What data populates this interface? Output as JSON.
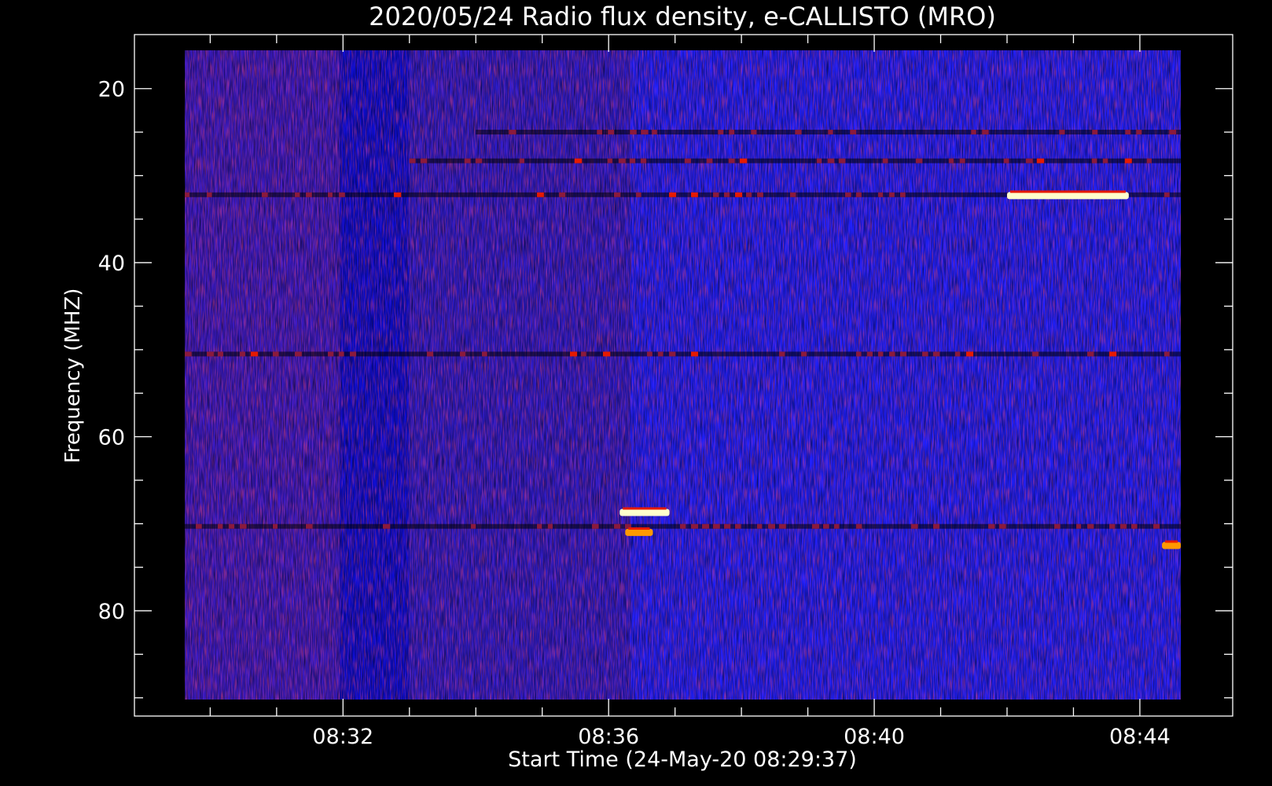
{
  "chart_data": {
    "type": "heatmap",
    "title": "2020/05/24  Radio flux density, e-CALLISTO (MRO)",
    "xlabel": "Start Time (24-May-20 08:29:37)",
    "ylabel": "Frequency (MHZ)",
    "x_range": [
      "08:29:37",
      "08:44:37"
    ],
    "y_range": [
      90.2,
      15.6
    ],
    "y_inverted": true,
    "x_ticks": [
      "08:32",
      "08:36",
      "08:40",
      "08:44"
    ],
    "y_ticks": [
      20,
      40,
      60,
      80
    ],
    "colormap": [
      "#000000",
      "#0000ff",
      "#8b1a3c",
      "#e61a00",
      "#ff9900",
      "#ffffcc"
    ],
    "background_color": "#1a1aff",
    "features": [
      {
        "kind": "band",
        "freq_mhz": 32.2,
        "t_start": "08:29:37",
        "t_end": "08:44:37",
        "intensity": 0.75
      },
      {
        "kind": "band",
        "freq_mhz": 28.3,
        "t_start": "08:33:00",
        "t_end": "08:44:37",
        "intensity": 0.7
      },
      {
        "kind": "band",
        "freq_mhz": 25.0,
        "t_start": "08:34:00",
        "t_end": "08:44:37",
        "intensity": 0.65
      },
      {
        "kind": "band",
        "freq_mhz": 50.5,
        "t_start": "08:29:37",
        "t_end": "08:44:37",
        "intensity": 0.7
      },
      {
        "kind": "band",
        "freq_mhz": 70.3,
        "t_start": "08:29:37",
        "t_end": "08:44:37",
        "intensity": 0.55
      },
      {
        "kind": "burst",
        "freq_mhz": 68.7,
        "t_start": "08:36:10",
        "t_end": "08:36:55",
        "intensity": 1.0
      },
      {
        "kind": "burst",
        "freq_mhz": 71.0,
        "t_start": "08:36:15",
        "t_end": "08:36:40",
        "intensity": 0.85
      },
      {
        "kind": "burst",
        "freq_mhz": 32.3,
        "t_start": "08:42:00",
        "t_end": "08:43:50",
        "intensity": 0.95
      },
      {
        "kind": "burst",
        "freq_mhz": 72.5,
        "t_start": "08:44:20",
        "t_end": "08:44:37",
        "intensity": 0.9
      }
    ]
  }
}
